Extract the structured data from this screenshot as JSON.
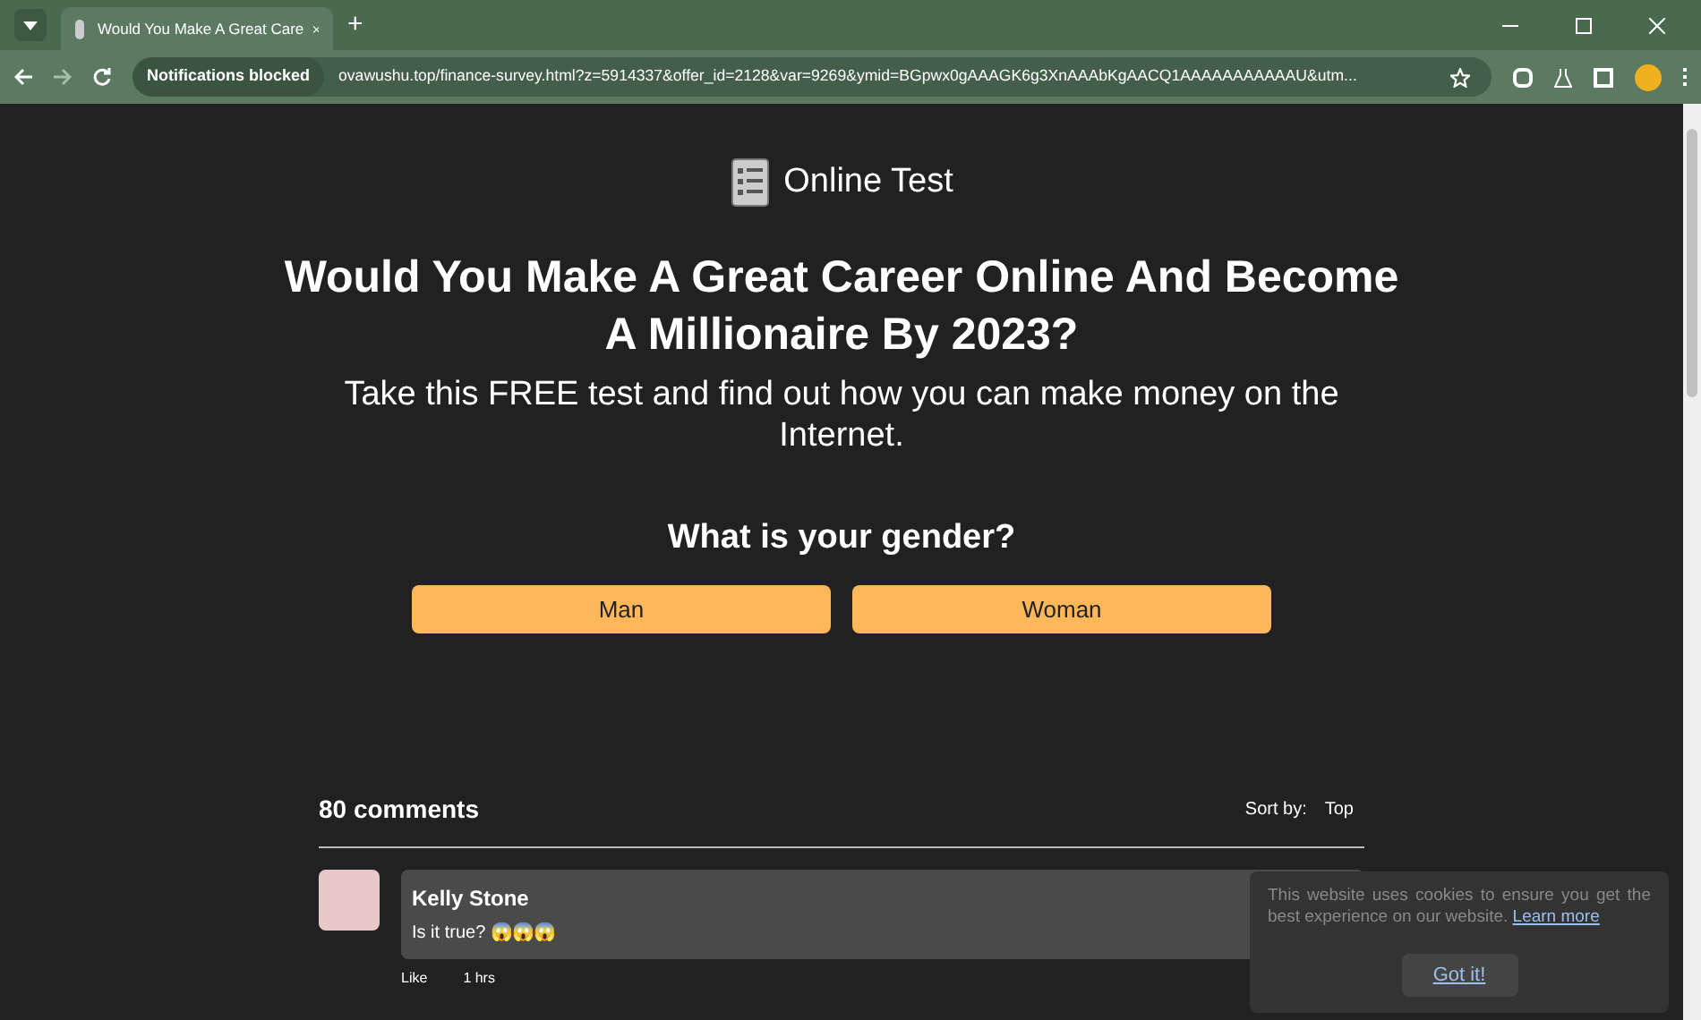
{
  "browser": {
    "tab_title": "Would You Make A Great Care",
    "new_tab": "+",
    "notifications": "Notifications blocked",
    "url": "ovawushu.top/finance-survey.html?z=5914337&offer_id=2128&var=9269&ymid=BGpwx0gAAAGK6g3XnAAAbKgAACQ1AAAAAAAAAAAU&utm..."
  },
  "brand": "Online Test",
  "headline": "Would You Make A Great Career Online And Become A Millionaire By 2023?",
  "subheadline": "Take this FREE test and find out how you can make money on the Internet.",
  "question": "What is your gender?",
  "answers": [
    "Man",
    "Woman"
  ],
  "comments": {
    "count": "80 comments",
    "sort_label": "Sort by:",
    "sort_value": "Top",
    "items": [
      {
        "author": "Kelly Stone",
        "text": "Is it true? 😱😱😱",
        "like": "Like",
        "time": "1 hrs"
      }
    ]
  },
  "cookie": {
    "text": "This website uses cookies to ensure you get the best experience on our website.",
    "link": "Learn more",
    "button": "Got it!"
  }
}
